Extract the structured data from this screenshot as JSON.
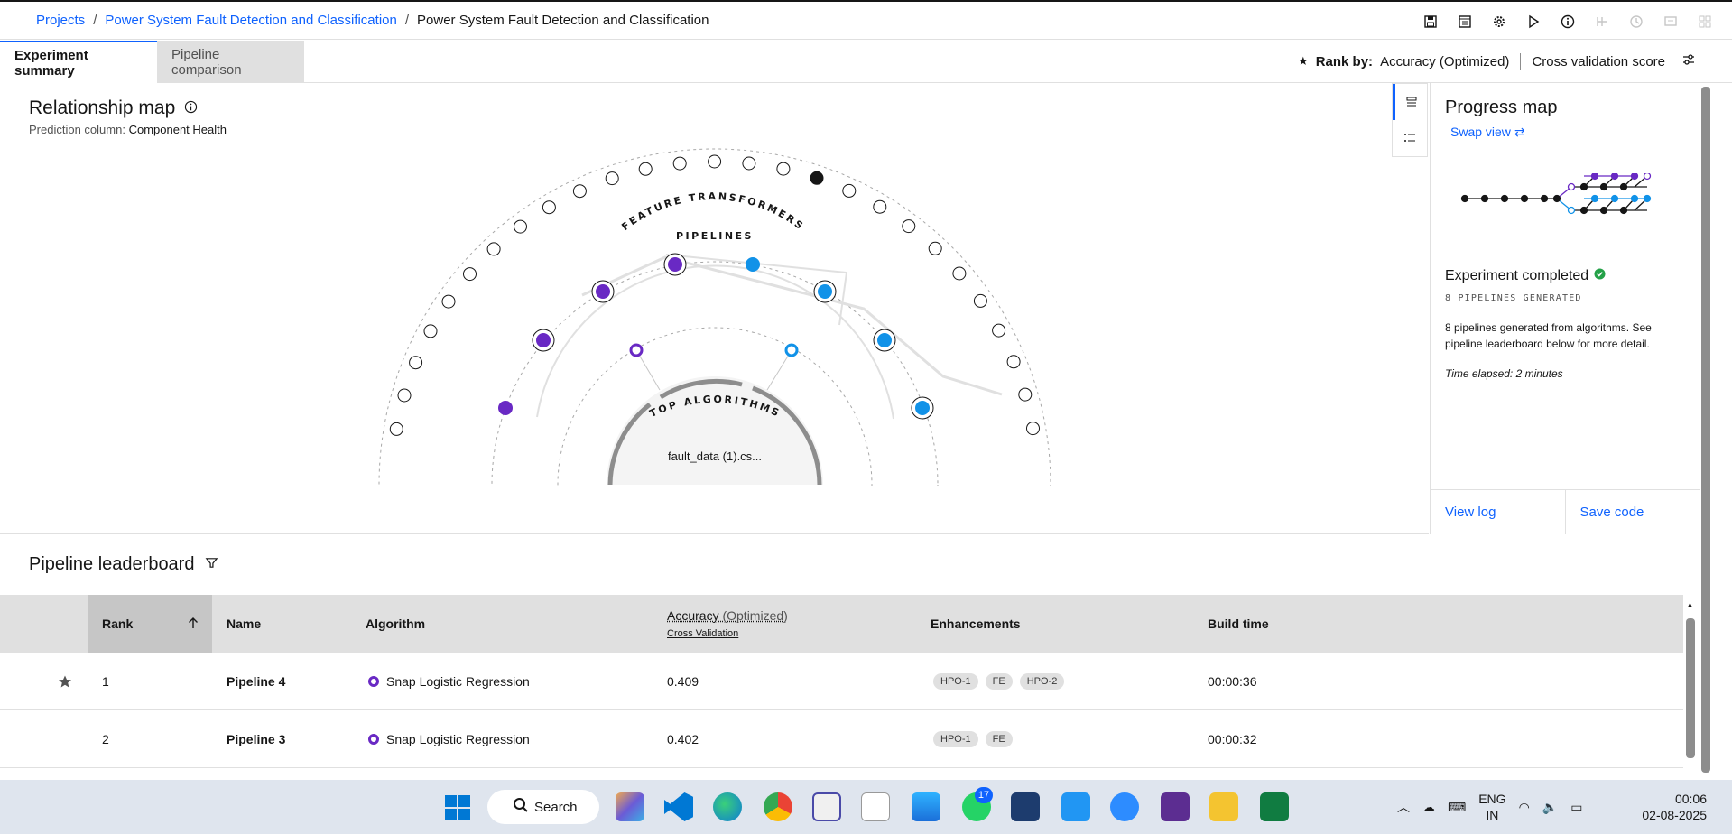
{
  "breadcrumb": {
    "items": [
      "Projects",
      "Power System Fault Detection and Classification"
    ],
    "current": "Power System Fault Detection and Classification"
  },
  "tabs": {
    "summary": "Experiment summary",
    "comparison": "Pipeline comparison"
  },
  "rank_by": {
    "label": "Rank by:",
    "metric": "Accuracy (Optimized)",
    "mode": "Cross validation score"
  },
  "relationship_map": {
    "title": "Relationship map",
    "prediction_label": "Prediction column:",
    "prediction_value": "Component Health",
    "ring_labels": {
      "features": "FEATURE TRANSFORMERS",
      "pipelines": "PIPELINES",
      "algorithms": "TOP ALGORITHMS"
    },
    "dataset": "fault_data (1).cs..."
  },
  "progress_map": {
    "title": "Progress map",
    "swap": "Swap view",
    "status": "Experiment completed",
    "count": "8 PIPELINES GENERATED",
    "description": "8 pipelines generated from algorithms. See pipeline leaderboard below for more detail.",
    "elapsed": "Time elapsed: 2 minutes",
    "view_log": "View log",
    "save_code": "Save code"
  },
  "leaderboard": {
    "title": "Pipeline leaderboard",
    "columns": {
      "rank": "Rank",
      "name": "Name",
      "algorithm": "Algorithm",
      "accuracy": "Accuracy",
      "accuracy_opt": "(Optimized)",
      "accuracy_sub": "Cross Validation",
      "enhancements": "Enhancements",
      "build_time": "Build time"
    },
    "rows": [
      {
        "rank": "1",
        "name": "Pipeline 4",
        "algorithm": "Snap Logistic Regression",
        "accuracy": "0.409",
        "enh": [
          "HPO-1",
          "FE",
          "HPO-2"
        ],
        "time": "00:00:36"
      },
      {
        "rank": "2",
        "name": "Pipeline 3",
        "algorithm": "Snap Logistic Regression",
        "accuracy": "0.402",
        "enh": [
          "HPO-1",
          "FE"
        ],
        "time": "00:00:32"
      }
    ]
  },
  "taskbar": {
    "search": "Search",
    "lang1": "ENG",
    "lang2": "IN",
    "time": "00:06",
    "date": "02-08-2025",
    "whatsapp_badge": "17"
  },
  "colors": {
    "accent": "#0f62fe",
    "purple": "#6929c4",
    "cyan": "#1192e8",
    "success": "#24a148"
  }
}
